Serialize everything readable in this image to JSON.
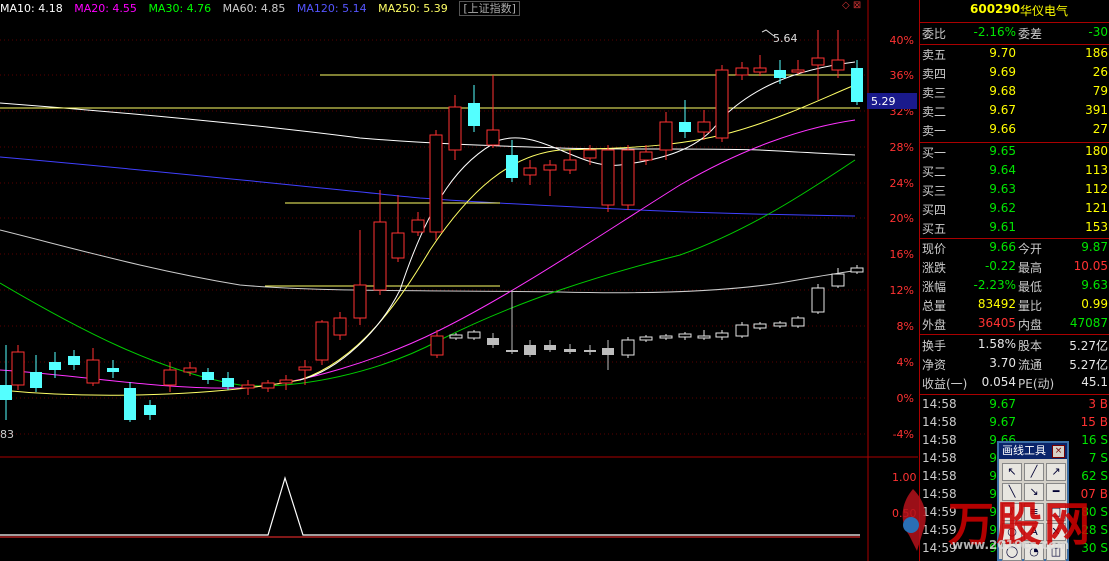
{
  "chart_header": {
    "ma_items": [
      {
        "label": "MA10: 4.18",
        "color": "#ffffff"
      },
      {
        "label": "MA20: 4.55",
        "color": "#ff00ff"
      },
      {
        "label": "MA30: 4.76",
        "color": "#00ff00"
      },
      {
        "label": "MA60: 4.85",
        "color": "#cccccc"
      },
      {
        "label": "MA120: 5.14",
        "color": "#3333ff"
      },
      {
        "label": "MA250: 5.39",
        "color": "#ffff66"
      }
    ],
    "index_tag": "[上证指数]"
  },
  "chart_data": {
    "type": "candlestick",
    "price_labels": [
      "40%",
      "36%",
      "32%",
      "28%",
      "24%",
      "20%",
      "16%",
      "12%",
      "8%",
      "4%",
      "0%",
      "-4%"
    ],
    "sub_labels": [
      "1.00",
      "0.50"
    ],
    "high_marker": "5.64",
    "last_price_tag": "5.29",
    "left_edge_label": "83"
  },
  "quote": {
    "code": "600290",
    "name": "华仪电气",
    "weibi_label": "委比",
    "weibi": "-2.16%",
    "weicha_label": "委差",
    "weicha": "-30",
    "asks": [
      {
        "label": "卖五",
        "price": "9.70",
        "vol": "186"
      },
      {
        "label": "卖四",
        "price": "9.69",
        "vol": "26"
      },
      {
        "label": "卖三",
        "price": "9.68",
        "vol": "79"
      },
      {
        "label": "卖二",
        "price": "9.67",
        "vol": "391"
      },
      {
        "label": "卖一",
        "price": "9.66",
        "vol": "27"
      }
    ],
    "bids": [
      {
        "label": "买一",
        "price": "9.65",
        "vol": "180"
      },
      {
        "label": "买二",
        "price": "9.64",
        "vol": "113"
      },
      {
        "label": "买三",
        "price": "9.63",
        "vol": "112"
      },
      {
        "label": "买四",
        "price": "9.62",
        "vol": "121"
      },
      {
        "label": "买五",
        "price": "9.61",
        "vol": "153"
      }
    ],
    "stats": [
      {
        "l1": "现价",
        "v1": "9.66",
        "c1": "green",
        "l2": "今开",
        "v2": "9.87",
        "c2": "green"
      },
      {
        "l1": "涨跌",
        "v1": "-0.22",
        "c1": "green",
        "l2": "最高",
        "v2": "10.05",
        "c2": "red"
      },
      {
        "l1": "涨幅",
        "v1": "-2.23%",
        "c1": "green",
        "l2": "最低",
        "v2": "9.63",
        "c2": "green"
      },
      {
        "l1": "总量",
        "v1": "83492",
        "c1": "yellow",
        "l2": "量比",
        "v2": "0.99",
        "c2": "yellow"
      },
      {
        "l1": "外盘",
        "v1": "36405",
        "c1": "red",
        "l2": "内盘",
        "v2": "47087",
        "c2": "green"
      }
    ],
    "stats2": [
      {
        "l1": "换手",
        "v1": "1.58%",
        "l2": "股本",
        "v2": "5.27亿"
      },
      {
        "l1": "净资",
        "v1": "3.70",
        "l2": "流通",
        "v2": "5.27亿"
      },
      {
        "l1": "收益(一)",
        "v1": "0.054",
        "l2": "PE(动)",
        "v2": "45.1"
      }
    ],
    "ticks": [
      {
        "time": "14:58",
        "price": "9.67",
        "vol": "3",
        "side": "B"
      },
      {
        "time": "14:58",
        "price": "9.67",
        "vol": "15",
        "side": "B"
      },
      {
        "time": "14:58",
        "price": "9.66",
        "vol": "16",
        "side": "S"
      },
      {
        "time": "14:58",
        "price": "9.66",
        "vol": "7",
        "side": "S"
      },
      {
        "time": "14:58",
        "price": "9.66",
        "vol": "62",
        "side": "S"
      },
      {
        "time": "14:58",
        "price": "9.67",
        "vol": "07",
        "side": "B"
      },
      {
        "time": "14:59",
        "price": "9.66",
        "vol": "80",
        "side": "S"
      },
      {
        "time": "14:59",
        "price": "9.66",
        "vol": "28",
        "side": "S"
      },
      {
        "time": "14:59",
        "price": "9.66",
        "vol": "30",
        "side": "S"
      }
    ]
  },
  "draw_tool": {
    "title": "画线工具",
    "close": "×"
  },
  "watermark": {
    "brand": "万股网",
    "url": "www.2010cc.com"
  }
}
